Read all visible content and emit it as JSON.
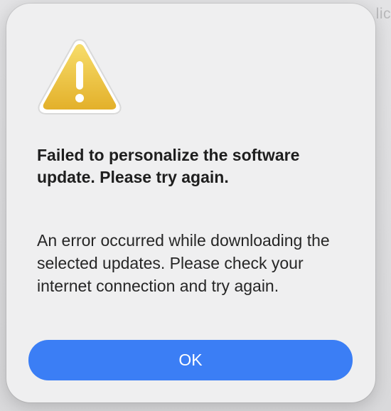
{
  "background": {
    "partial_text": "lic"
  },
  "dialog": {
    "icon": "warning-triangle-icon",
    "title": "Failed to personalize the software update. Please try again.",
    "message": "An error occurred while downloading the selected updates. Please check your internet connection and try again.",
    "ok_label": "OK"
  },
  "colors": {
    "accent": "#3b7ef5",
    "warning": "#f2c53c",
    "dialog_bg": "#efeff0"
  }
}
